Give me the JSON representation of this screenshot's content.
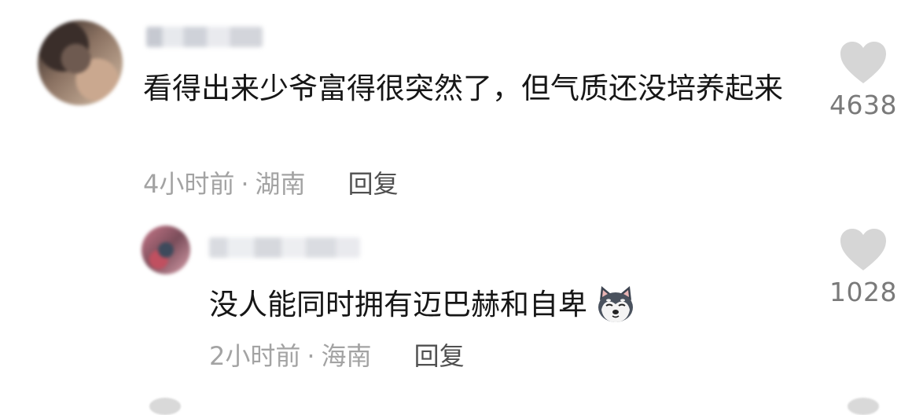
{
  "comments": [
    {
      "text": "看得出来少爷富得很突然了，但气质还没培养起来",
      "time": "4小时前",
      "separator": "·",
      "location": "湖南",
      "reply_label": "回复",
      "likes": "4638",
      "icons": {
        "avatar": "avatar-blurred",
        "like": "heart-icon"
      }
    },
    {
      "text": "没人能同时拥有迈巴赫和自卑",
      "time": "2小时前",
      "separator": "·",
      "location": "海南",
      "reply_label": "回复",
      "likes": "1028",
      "icons": {
        "avatar": "avatar-blurred",
        "like": "heart-icon",
        "emoji": "husky-dog-emoji"
      }
    }
  ],
  "colors": {
    "text": "#161616",
    "meta": "#a3a3a3",
    "reply": "#505050",
    "heart": "#d6d6d6",
    "count": "#7a7a7a"
  }
}
